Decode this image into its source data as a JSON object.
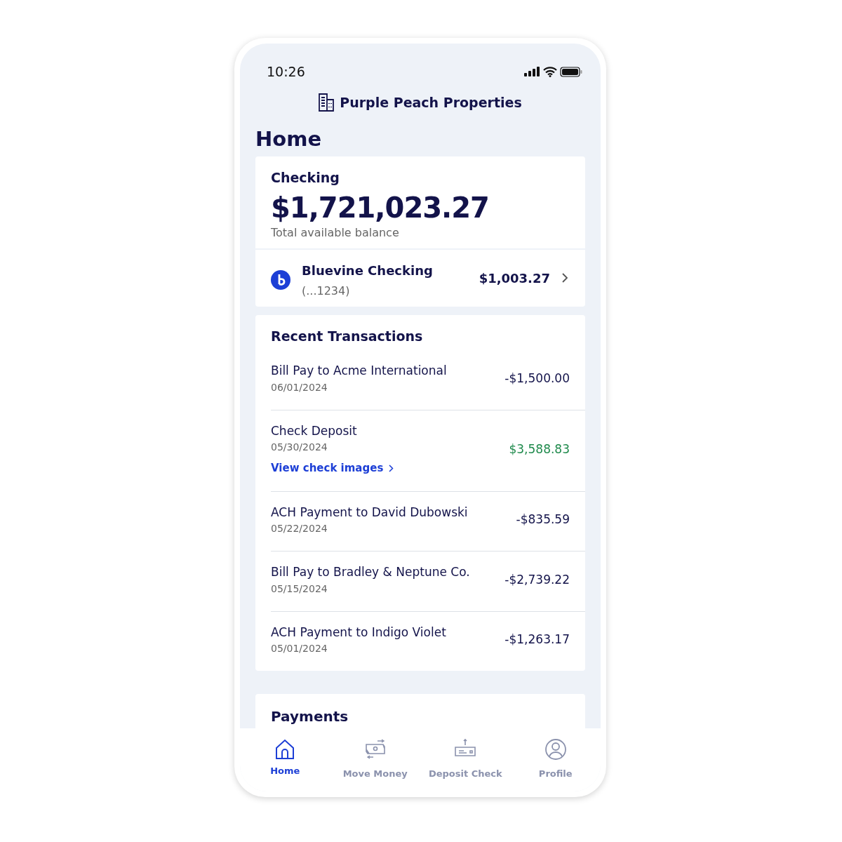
{
  "status_bar": {
    "time": "10:26"
  },
  "header": {
    "title": "Purple Peach Properties"
  },
  "page_title": "Home",
  "balance_card": {
    "title": "Checking",
    "balance": "$1,721,023.27",
    "caption": "Total available balance"
  },
  "account": {
    "name": "Bluevine Checking",
    "number": "(...1234)",
    "amount": "$1,003.27"
  },
  "transactions": {
    "title": "Recent Transactions",
    "items": [
      {
        "description": "Bill Pay to Acme International",
        "date": "06/01/2024",
        "amount": "-$1,500.00",
        "kind": "debit"
      },
      {
        "description": "Check Deposit",
        "date": "05/30/2024",
        "amount": "$3,588.83",
        "kind": "credit",
        "link": "View check images"
      },
      {
        "description": "ACH Payment to David Dubowski",
        "date": "05/22/2024",
        "amount": "-$835.59",
        "kind": "debit"
      },
      {
        "description": "Bill Pay to Bradley & Neptune Co.",
        "date": "05/15/2024",
        "amount": "-$2,739.22",
        "kind": "debit"
      },
      {
        "description": "ACH Payment to Indigo Violet",
        "date": "05/01/2024",
        "amount": "-$1,263.17",
        "kind": "debit"
      }
    ]
  },
  "payments": {
    "title": "Payments"
  },
  "tab_bar": [
    {
      "label": "Home",
      "kind": "home",
      "selected": true
    },
    {
      "label": "Move Money",
      "kind": "money",
      "selected": false
    },
    {
      "label": "Deposit Check",
      "kind": "check",
      "selected": false
    },
    {
      "label": "Profile",
      "kind": "profile",
      "selected": false
    }
  ]
}
